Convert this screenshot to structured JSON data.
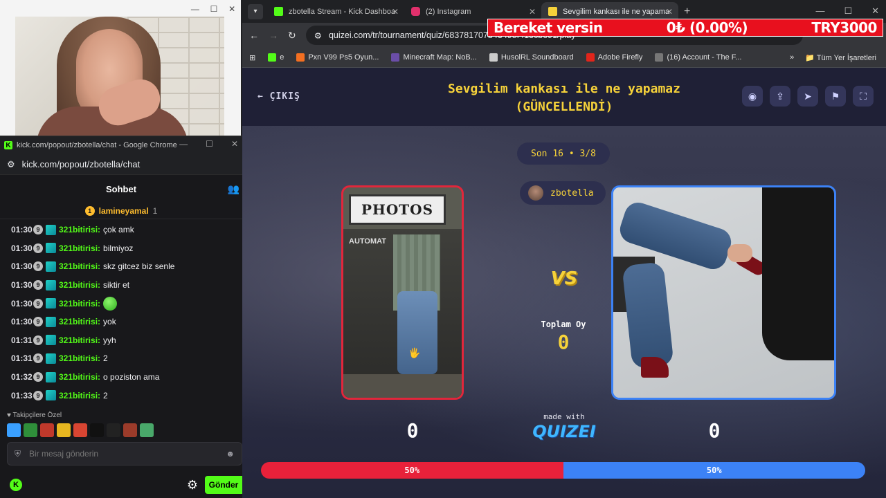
{
  "webcam": {
    "controls": [
      "—",
      "☐",
      "✕"
    ]
  },
  "chat_window": {
    "title": "kick.com/popout/zbotella/chat - Google Chrome",
    "url": "kick.com/popout/zbotella/chat",
    "header": "Sohbet",
    "pinned": {
      "rank": "1",
      "user": "lamineyamal",
      "count": "1"
    },
    "messages": [
      {
        "time": "01:30",
        "sub": "9",
        "user": "321bitirisi:",
        "text": "çok amk"
      },
      {
        "time": "01:30",
        "sub": "9",
        "user": "321bitirisi:",
        "text": "bilmiyoz"
      },
      {
        "time": "01:30",
        "sub": "9",
        "user": "321bitirisi:",
        "text": "skz gitcez biz senle"
      },
      {
        "time": "01:30",
        "sub": "9",
        "user": "321bitirisi:",
        "text": "siktir et"
      },
      {
        "time": "01:30",
        "sub": "9",
        "user": "321bitirisi:",
        "text": ""
      },
      {
        "time": "01:30",
        "sub": "9",
        "user": "321bitirisi:",
        "text": "yok"
      },
      {
        "time": "01:31",
        "sub": "9",
        "user": "321bitirisi:",
        "text": "yyh"
      },
      {
        "time": "01:31",
        "sub": "9",
        "user": "321bitirisi:",
        "text": "2"
      },
      {
        "time": "01:32",
        "sub": "9",
        "user": "321bitirisi:",
        "text": "o poziston ama"
      },
      {
        "time": "01:33",
        "sub": "9",
        "user": "321bitirisi:",
        "text": "2"
      }
    ],
    "emote_section_label": "♥ Takipçilere Özel",
    "emote_colors": [
      "#3aa0ff",
      "#2f8f3a",
      "#c0392b",
      "#e7b720",
      "#d84532",
      "#111111",
      "#222222",
      "#9b3b2a",
      "#49a86a"
    ],
    "input_placeholder": "Bir mesaj gönderin",
    "send_label": "Gönder"
  },
  "browser": {
    "tabs": [
      {
        "label": "zbotella Stream - Kick Dashboa",
        "color": "#53fc18"
      },
      {
        "label": "(2) Instagram",
        "color": "#e1306c"
      },
      {
        "label": "Sevgilim kankası ile ne yapama",
        "color": "#f6d23a",
        "active": true
      }
    ],
    "url": "quizei.com/tr/tournament/quiz/683781707b43498f413cbe91/play",
    "bookmarks": [
      {
        "label": "e",
        "color": "#53fc18"
      },
      {
        "label": "Pxn V99 Ps5 Oyun...",
        "color": "#f36f21"
      },
      {
        "label": "Minecraft Map: NoB...",
        "color": "#6b4ea8"
      },
      {
        "label": "HusolRL Soundboard",
        "color": "#cccccc"
      },
      {
        "label": "Adobe Firefly",
        "color": "#e1251b"
      },
      {
        "label": "(16) Account - The F...",
        "color": "#777777"
      }
    ],
    "bookmarks_more": "»",
    "all_bookmarks": "Tüm Yer İşaretleri"
  },
  "ticker": {
    "left": "Bereket versin",
    "middle": "0₺ (0.00%)",
    "right": "TRY3000"
  },
  "quiz": {
    "exit_label": "← ÇIKIŞ",
    "title_line1": "Sevgilim kankası ile ne yapamaz",
    "title_line2": "(GÜNCELLENDİ)",
    "round": "Son 16 • 3/8",
    "streamer": "zbotella",
    "vs": "VS",
    "total_label": "Toplam Oy",
    "total_value": "0",
    "score_left": "0",
    "score_right": "0",
    "made_with": "made with",
    "logo": "QUIZEI",
    "photo_sign": "PHOTOS",
    "photo_sub": "AUTOMAT",
    "percent_left_label": "50%",
    "percent_right_label": "50%",
    "percent_left": 50,
    "percent_right": 50,
    "colors": {
      "left": "#e8213a",
      "right": "#3c82f6",
      "accent": "#f6d23a"
    }
  }
}
